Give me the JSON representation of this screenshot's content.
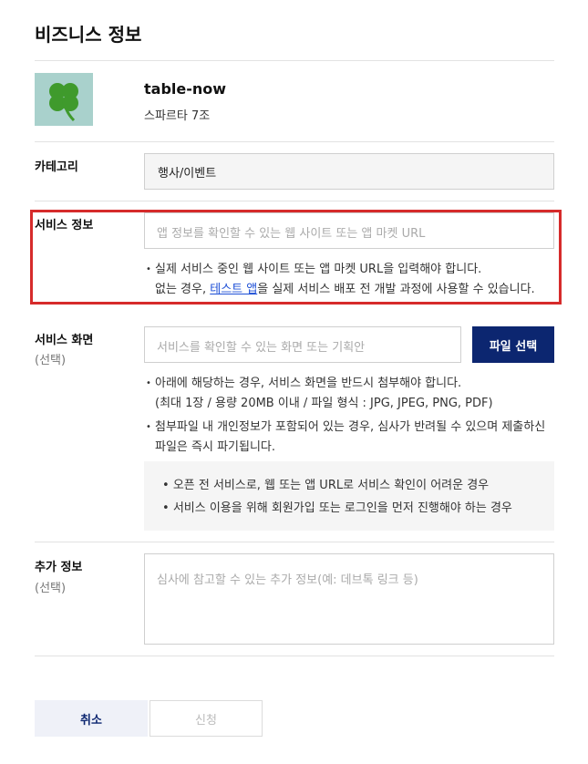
{
  "page": {
    "title": "비즈니스 정보"
  },
  "app": {
    "name": "table-now",
    "team": "스파르타 7조",
    "logo_icon": "clover-icon"
  },
  "category": {
    "label": "카테고리",
    "value": "행사/이벤트"
  },
  "service_info": {
    "label": "서비스 정보",
    "placeholder": "앱 정보를 확인할 수 있는 웹 사이트 또는 앱 마켓 URL",
    "note_line1": "실제 서비스 중인 웹 사이트 또는 앱 마켓 URL을 입력해야 합니다.",
    "note_line2_prefix": "없는 경우, ",
    "note_link": "테스트 앱",
    "note_line2_suffix": "을 실제 서비스 배포 전 개발 과정에 사용할 수 있습니다.",
    "highlight_color": "#d62b2b"
  },
  "service_screen": {
    "label": "서비스 화면",
    "sublabel": "(선택)",
    "placeholder": "서비스를 확인할 수 있는 화면 또는 기획안",
    "file_button": "파일 선택",
    "note1_line1": "아래에 해당하는 경우, 서비스 화면을 반드시 첨부해야 합니다.",
    "note1_line2": "(최대 1장 / 용량 20MB 이내 / 파일 형식 : JPG, JPEG, PNG, PDF)",
    "note2_line1": "첨부파일 내 개인정보가 포함되어 있는 경우, 심사가 반려될 수 있으며 제출하신",
    "note2_line2": "파일은 즉시 파기됩니다.",
    "cases": [
      "오픈 전 서비스로, 웹 또는 앱 URL로 서비스 확인이 어려운 경우",
      "서비스 이용을 위해 회원가입 또는 로그인을 먼저 진행해야 하는 경우"
    ]
  },
  "extra_info": {
    "label": "추가 정보",
    "sublabel": "(선택)",
    "placeholder": "심사에 참고할 수 있는 추가 정보(예: 데브톡 링크 등)"
  },
  "actions": {
    "cancel": "취소",
    "submit": "신청"
  },
  "colors": {
    "primary": "#0c2670",
    "link": "#1d4fd6"
  }
}
